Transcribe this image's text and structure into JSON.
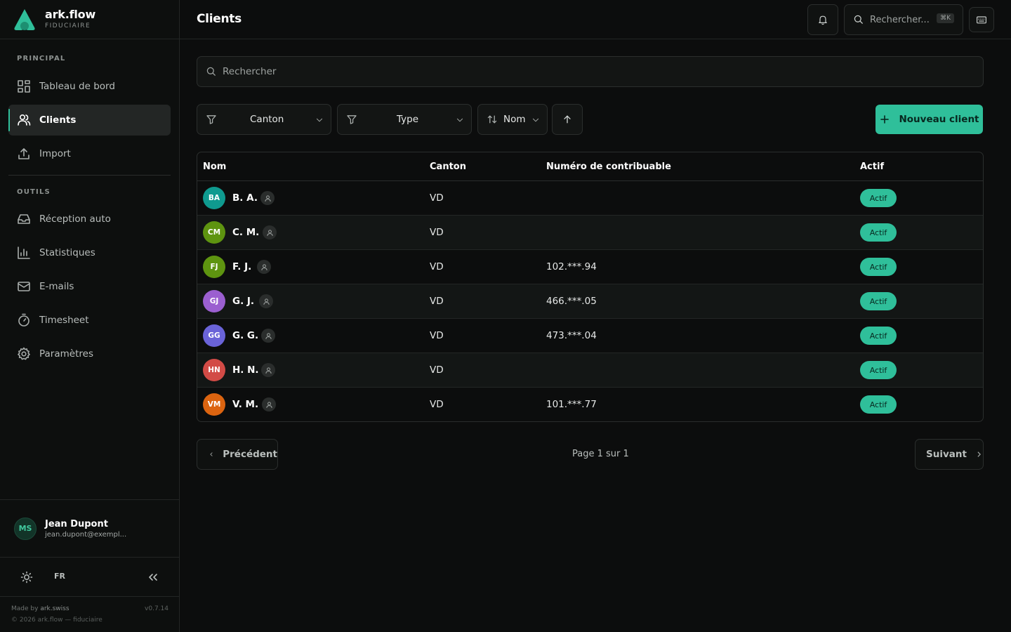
{
  "brand": {
    "name": "ark.flow",
    "subtitle": "FIDUCIAIRE"
  },
  "sidebar": {
    "section_principal": "PRINCIPAL",
    "section_outils": "OUTILS",
    "principal_items": [
      {
        "label": "Tableau de bord",
        "icon": "dashboard-icon"
      },
      {
        "label": "Clients",
        "icon": "users-icon",
        "active": true
      },
      {
        "label": "Import",
        "icon": "upload-icon"
      }
    ],
    "outils_items": [
      {
        "label": "Réception auto",
        "icon": "inbox-icon"
      },
      {
        "label": "Statistiques",
        "icon": "chart-icon"
      },
      {
        "label": "E-mails",
        "icon": "mail-icon"
      },
      {
        "label": "Timesheet",
        "icon": "timer-icon"
      },
      {
        "label": "Paramètres",
        "icon": "gear-icon"
      }
    ],
    "user": {
      "initials": "MS",
      "name": "Jean Dupont",
      "email": "jean.dupont@exempl..."
    },
    "language": "FR",
    "footer": {
      "made_by_prefix": "Made by",
      "made_by_name": "ark.swiss",
      "version": "v0.7.14",
      "copyright": "© 2026 ark.flow — fiduciaire"
    }
  },
  "header": {
    "title": "Clients",
    "search_placeholder": "Rechercher...",
    "search_shortcut": "⌘K"
  },
  "main": {
    "search_placeholder": "Rechercher",
    "filters": {
      "canton": "Canton",
      "type": "Type",
      "sort": "Nom"
    },
    "new_client_label": "Nouveau client",
    "table": {
      "headers": {
        "name": "Nom",
        "canton": "Canton",
        "tax_number": "Numéro de contribuable",
        "active": "Actif"
      },
      "rows": [
        {
          "initials": "BA",
          "name": "B. A.",
          "canton": "VD",
          "tax_number": "",
          "status": "Actif",
          "avatar_color": "#0f9a8f"
        },
        {
          "initials": "CM",
          "name": "C. M.",
          "canton": "VD",
          "tax_number": "",
          "status": "Actif",
          "avatar_color": "#5e9410"
        },
        {
          "initials": "FJ",
          "name": "F. J.",
          "canton": "VD",
          "tax_number": "102.***.94",
          "status": "Actif",
          "avatar_color": "#5e9410"
        },
        {
          "initials": "GJ",
          "name": "G. J.",
          "canton": "VD",
          "tax_number": "466.***.05",
          "status": "Actif",
          "avatar_color": "#9b5fd0"
        },
        {
          "initials": "GG",
          "name": "G. G.",
          "canton": "VD",
          "tax_number": "473.***.04",
          "status": "Actif",
          "avatar_color": "#6a63d8"
        },
        {
          "initials": "HN",
          "name": "H. N.",
          "canton": "VD",
          "tax_number": "",
          "status": "Actif",
          "avatar_color": "#d24b46"
        },
        {
          "initials": "VM",
          "name": "V. M.",
          "canton": "VD",
          "tax_number": "101.***.77",
          "status": "Actif",
          "avatar_color": "#dc6410"
        }
      ]
    },
    "pagination": {
      "previous": "Précédent",
      "info": "Page 1 sur 1",
      "next": "Suivant"
    }
  },
  "colors": {
    "accent": "#2fbf9a",
    "background": "#0c0d0d"
  }
}
